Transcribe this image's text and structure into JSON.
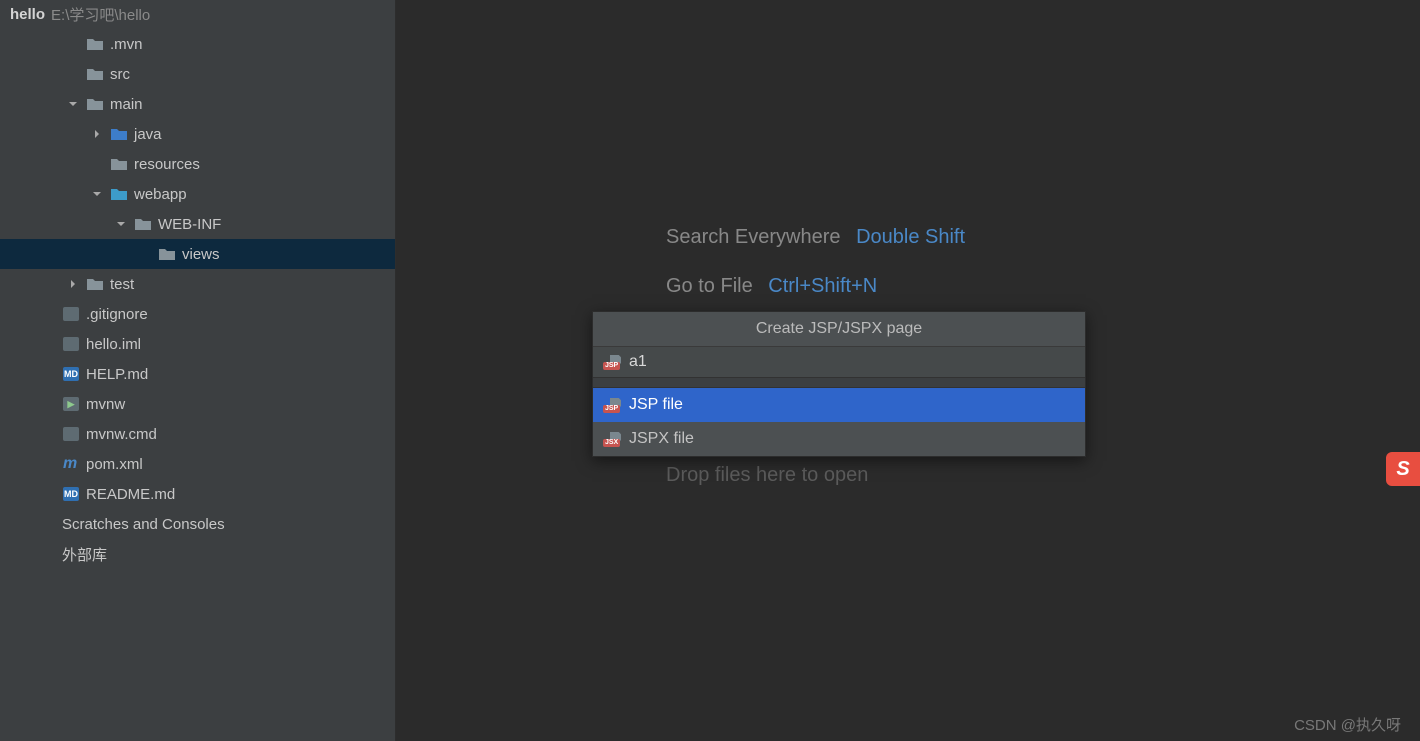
{
  "project": {
    "name": "hello",
    "path": "E:\\学习吧\\hello"
  },
  "tree": [
    {
      "indent": 0,
      "arrow": "",
      "icon": "folder",
      "label": ".mvn",
      "selected": false
    },
    {
      "indent": 0,
      "arrow": "",
      "icon": "folder",
      "label": "src",
      "selected": false
    },
    {
      "indent": 0,
      "arrow": "down",
      "icon": "folder",
      "label": "main",
      "selected": false
    },
    {
      "indent": 1,
      "arrow": "right",
      "icon": "folder-blue",
      "label": "java",
      "selected": false
    },
    {
      "indent": 1,
      "arrow": "",
      "icon": "folder-res",
      "label": "resources",
      "selected": false
    },
    {
      "indent": 1,
      "arrow": "down",
      "icon": "folder-web",
      "label": "webapp",
      "selected": false
    },
    {
      "indent": 2,
      "arrow": "down",
      "icon": "folder",
      "label": "WEB-INF",
      "selected": false
    },
    {
      "indent": 3,
      "arrow": "",
      "icon": "folder",
      "label": "views",
      "selected": true
    },
    {
      "indent": 0,
      "arrow": "right",
      "icon": "folder",
      "label": "test",
      "selected": false
    },
    {
      "indent": -1,
      "arrow": "",
      "icon": "file-git",
      "label": ".gitignore",
      "selected": false
    },
    {
      "indent": -1,
      "arrow": "",
      "icon": "file",
      "label": "hello.iml",
      "selected": false
    },
    {
      "indent": -1,
      "arrow": "",
      "icon": "file-md",
      "label": "HELP.md",
      "selected": false
    },
    {
      "indent": -1,
      "arrow": "",
      "icon": "file-sh",
      "label": "mvnw",
      "selected": false
    },
    {
      "indent": -1,
      "arrow": "",
      "icon": "file",
      "label": "mvnw.cmd",
      "selected": false
    },
    {
      "indent": -1,
      "arrow": "",
      "icon": "file-m",
      "label": "pom.xml",
      "selected": false
    },
    {
      "indent": -1,
      "arrow": "",
      "icon": "file-md",
      "label": "README.md",
      "selected": false
    },
    {
      "indent": -2,
      "arrow": "",
      "icon": "",
      "label": "Scratches and Consoles",
      "selected": false
    },
    {
      "indent": -2,
      "arrow": "",
      "icon": "",
      "label": "外部库",
      "selected": false
    }
  ],
  "hints": {
    "search": {
      "text": "Search Everywhere",
      "key": "Double Shift"
    },
    "gotofile": {
      "text": "Go to File",
      "key": "Ctrl+Shift+N"
    }
  },
  "drop_hint": "Drop files here to open",
  "popup": {
    "title": "Create JSP/JSPX page",
    "input_value": "a1",
    "options": [
      {
        "icon": "jsp",
        "label": "JSP file",
        "highlighted": true
      },
      {
        "icon": "jsx",
        "label": "JSPX file",
        "highlighted": false
      }
    ]
  },
  "watermark": "CSDN @执久呀",
  "side_badge": "S"
}
